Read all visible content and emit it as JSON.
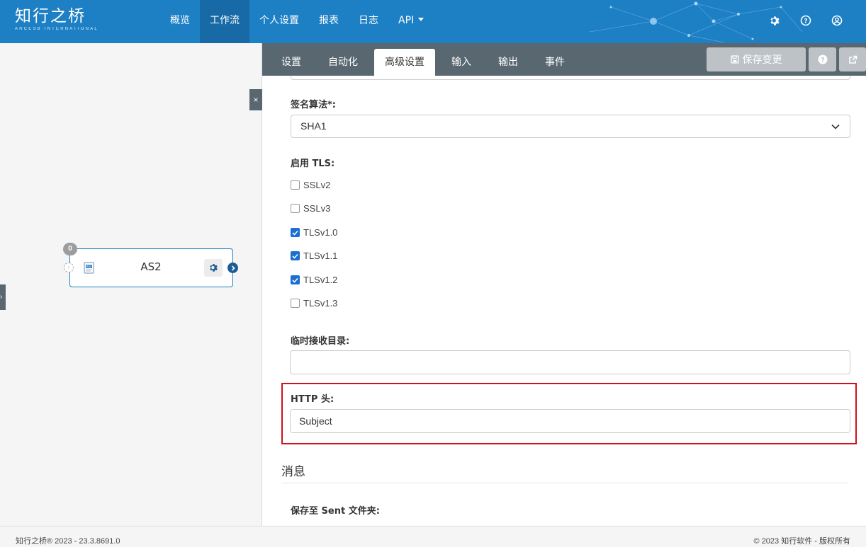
{
  "brand": {
    "name": "知行之桥",
    "subtitle": "ARCESB INTERNATIONAL"
  },
  "nav": {
    "items": [
      {
        "label": "概览",
        "active": false
      },
      {
        "label": "工作流",
        "active": true
      },
      {
        "label": "个人设置",
        "active": false
      },
      {
        "label": "报表",
        "active": false
      },
      {
        "label": "日志",
        "active": false
      },
      {
        "label": "API",
        "active": false,
        "dropdown": true
      }
    ],
    "icons": [
      "gear-icon",
      "question-circle-icon",
      "user-circle-icon"
    ]
  },
  "canvas": {
    "collapse_label": "×",
    "expand_label": "›",
    "node": {
      "label": "AS2",
      "badge": "0",
      "icon": "as2-connector-icon"
    }
  },
  "panel": {
    "tabs": [
      {
        "label": "设置",
        "active": false
      },
      {
        "label": "自动化",
        "active": false
      },
      {
        "label": "高级设置",
        "active": true
      },
      {
        "label": "输入",
        "active": false
      },
      {
        "label": "输出",
        "active": false
      },
      {
        "label": "事件",
        "active": false
      }
    ],
    "save_label": "保存变更"
  },
  "form": {
    "sign_algo_label": "签名算法*:",
    "sign_algo_value": "SHA1",
    "tls_label": "启用 TLS:",
    "tls_options": [
      {
        "label": "SSLv2",
        "checked": false
      },
      {
        "label": "SSLv3",
        "checked": false
      },
      {
        "label": "TLSv1.0",
        "checked": true
      },
      {
        "label": "TLSv1.1",
        "checked": true
      },
      {
        "label": "TLSv1.2",
        "checked": true
      },
      {
        "label": "TLSv1.3",
        "checked": false
      }
    ],
    "temp_dir_label": "临时接收目录:",
    "temp_dir_value": "",
    "http_header_label": "HTTP 头:",
    "http_header_value": "Subject",
    "message_section": "消息",
    "save_sent_label": "保存至 Sent 文件夹:"
  },
  "footer": {
    "left": "知行之桥® 2023 - 23.3.8691.0",
    "right": "© 2023 知行软件 - 版权所有"
  },
  "colors": {
    "nav_bg": "#1d7fc4",
    "tabbar_bg": "#596770",
    "highlight": "#d0101c",
    "checkbox": "#1a6fd0"
  }
}
